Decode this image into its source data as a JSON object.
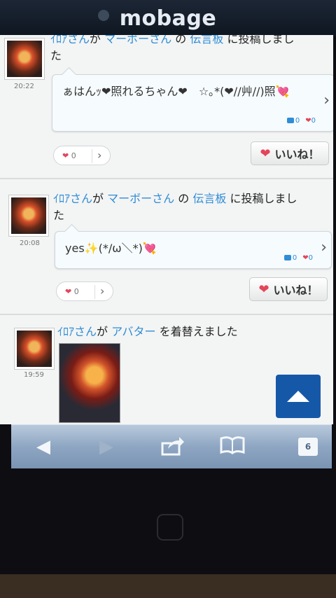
{
  "header": {
    "brand": "mobage"
  },
  "feed": [
    {
      "time": "20:22",
      "user": "ｲﾛｱさん",
      "particle1": "が",
      "target": "マーボーさん",
      "particle2": "の",
      "place": "伝言板",
      "action_line1": "に投稿しまし",
      "action_line2": "た",
      "message": "ぁはんｯ❤照れるちゃん❤　☆｡*(❤//艸//)照💘",
      "comment_count": "0",
      "heart_count": "0",
      "like_count": "0",
      "like_label": "いいね！"
    },
    {
      "time": "20:08",
      "user": "ｲﾛｱさん",
      "particle1": "が",
      "target": "マーボーさん",
      "particle2": "の",
      "place": "伝言板",
      "action_line1": "に投稿しまし",
      "action_line2": "た",
      "message": "yes✨(*/ω＼*)💘",
      "comment_count": "0",
      "heart_count": "0",
      "like_count": "0",
      "like_label": "いいね！"
    },
    {
      "time": "19:59",
      "user": "ｲﾛｱさん",
      "particle1": "が",
      "target": "アバター",
      "action": "を着替えました"
    }
  ],
  "toolbar": {
    "back_icon": "back-icon",
    "forward_icon": "forward-icon",
    "share_icon": "share-icon",
    "bookmarks_icon": "bookmarks-icon",
    "tabs_count": "6"
  },
  "colors": {
    "link": "#2f8dd6",
    "heart": "#e3455a",
    "scroll_top": "#1658a8"
  }
}
